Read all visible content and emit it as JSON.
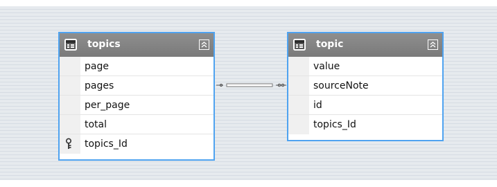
{
  "tables": [
    {
      "name": "topics",
      "fields": [
        {
          "label": "page",
          "key": false
        },
        {
          "label": "pages",
          "key": false
        },
        {
          "label": "per_page",
          "key": false
        },
        {
          "label": "total",
          "key": false
        },
        {
          "label": "topics_Id",
          "key": true
        }
      ]
    },
    {
      "name": "topic",
      "fields": [
        {
          "label": "value",
          "key": false
        },
        {
          "label": "sourceNote",
          "key": false
        },
        {
          "label": "id",
          "key": false
        },
        {
          "label": "topics_Id",
          "key": false
        }
      ]
    }
  ],
  "icons": {
    "table": "table-icon",
    "collapse": "collapse-icon",
    "key": "key-icon"
  },
  "colors": {
    "selection_border": "#4fa3f0",
    "header_background": "#858585",
    "canvas_background": "#e6eaee"
  }
}
